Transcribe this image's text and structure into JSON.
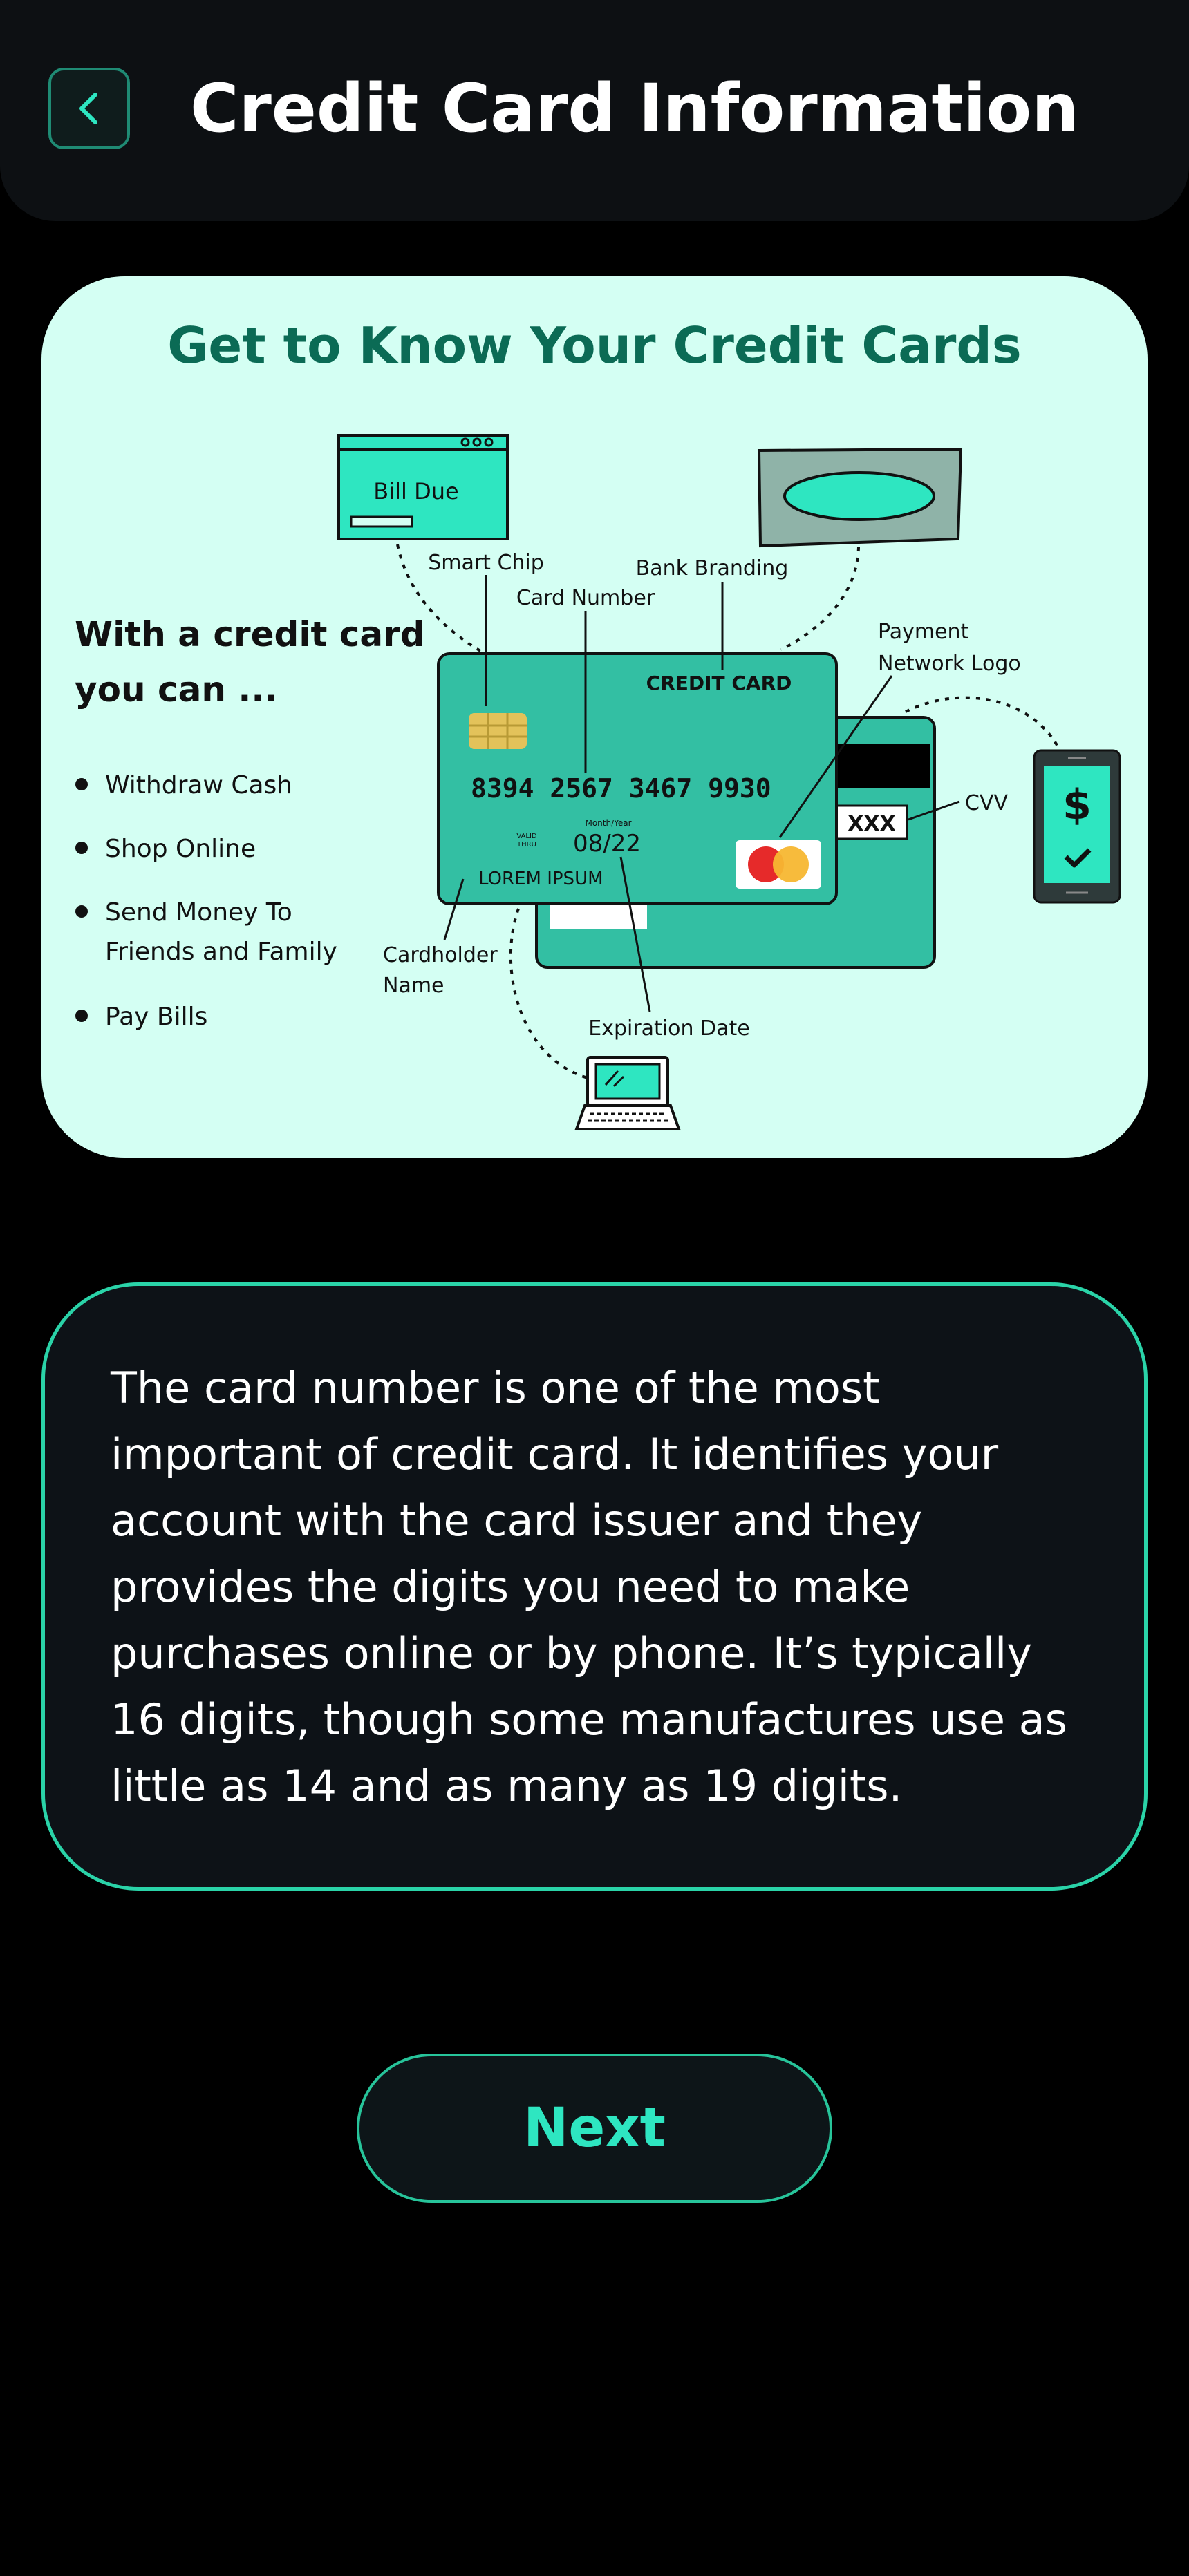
{
  "header": {
    "title": "Credit Card Information",
    "back_icon": "chevron-left-icon"
  },
  "info_card": {
    "heading": "Get to Know Your Credit Cards",
    "subheading_line1": "With a credit card",
    "subheading_line2": "you can ...",
    "bullets": [
      [
        "Withdraw Cash"
      ],
      [
        "Shop Online"
      ],
      [
        "Send Money To",
        "Friends and Family"
      ],
      [
        "Pay Bills"
      ]
    ],
    "illustration": {
      "bill_due": "Bill Due",
      "card_title": "CREDIT CARD",
      "card_number": "8394 2567 3467 9930",
      "valid_thru_line1": "VALID",
      "valid_thru_line2": "THRU",
      "month_year": "Month/Year",
      "expiry": "08/22",
      "cardholder": "LOREM IPSUM",
      "cvv_value": "XXX",
      "labels": {
        "smart_chip": "Smart Chip",
        "card_number": "Card Number",
        "bank_branding": "Bank Branding",
        "payment_network_line1": "Payment",
        "payment_network_line2": "Network Logo",
        "cvv": "CVV",
        "cardholder_line1": "Cardholder",
        "cardholder_line2": "Name",
        "expiration_date": "Expiration Date"
      },
      "phone_symbol": "$"
    },
    "colors": {
      "background": "#d4fff3",
      "heading": "#0b6b55",
      "card": "#33bfa3",
      "accent": "#2ee6c1"
    }
  },
  "description": {
    "lines": [
      "The card number is one of the most",
      "important of credit card. It identifies your",
      "account with the card issuer and they",
      "provides the digits you need to make",
      "purchases online or by phone. It’s typically",
      "16 digits, though some manufactures use as",
      "little as 14 and as many as 19 digits."
    ]
  },
  "next_button": {
    "label": "Next"
  }
}
